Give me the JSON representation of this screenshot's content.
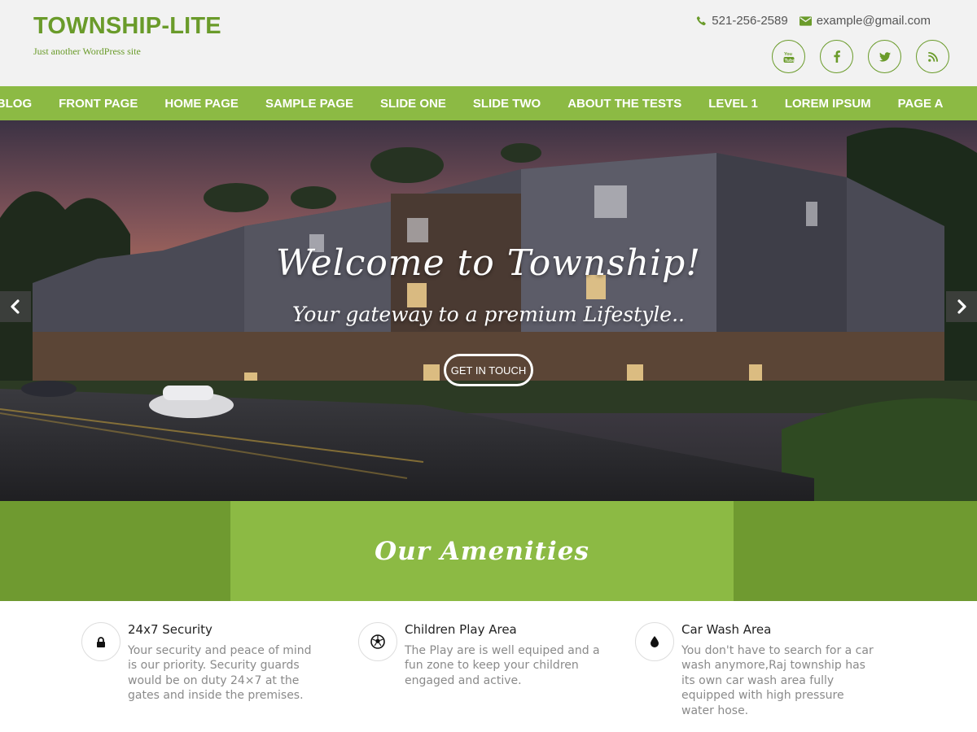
{
  "site": {
    "title": "TOWNSHIP-LITE",
    "tagline": "Just another WordPress site"
  },
  "contact": {
    "phone": "521-256-2589",
    "email": "example@gmail.com",
    "phone_icon": "phone-icon",
    "email_icon": "envelope-icon"
  },
  "socials": [
    {
      "icon": "youtube-icon"
    },
    {
      "icon": "facebook-icon"
    },
    {
      "icon": "twitter-icon"
    },
    {
      "icon": "rss-icon"
    }
  ],
  "nav": {
    "items": [
      "BLOG",
      "FRONT PAGE",
      "HOME PAGE",
      "SAMPLE PAGE",
      "SLIDE ONE",
      "SLIDE TWO",
      "ABOUT THE TESTS",
      "LEVEL 1",
      "LOREM IPSUM",
      "PAGE A"
    ]
  },
  "hero": {
    "title": "Welcome to Township!",
    "subtitle": "Your gateway to a premium Lifestyle..",
    "button": "GET IN TOUCH",
    "prev_icon": "chevron-left-icon",
    "next_icon": "chevron-right-icon"
  },
  "amenities": {
    "heading": "Our Amenities",
    "items": [
      {
        "title": "24x7 Security",
        "description": "Your security and peace of mind is our priority. Security guards would be on duty 24×7 at the gates and inside the premises.",
        "icon": "lock-icon"
      },
      {
        "title": "Children Play Area",
        "description": "The Play are is well equiped and a fun zone to keep your children engaged and active.",
        "icon": "soccer-ball-icon"
      },
      {
        "title": "Car Wash Area",
        "description": "You don't have to search for a car wash anymore,Raj township has its own car wash area fully equipped with high pressure water hose.",
        "icon": "water-drop-icon"
      }
    ]
  },
  "colors": {
    "brand_green": "#8cba44",
    "dark_green": "#6f9a30",
    "title_green": "#6a9b2a"
  }
}
